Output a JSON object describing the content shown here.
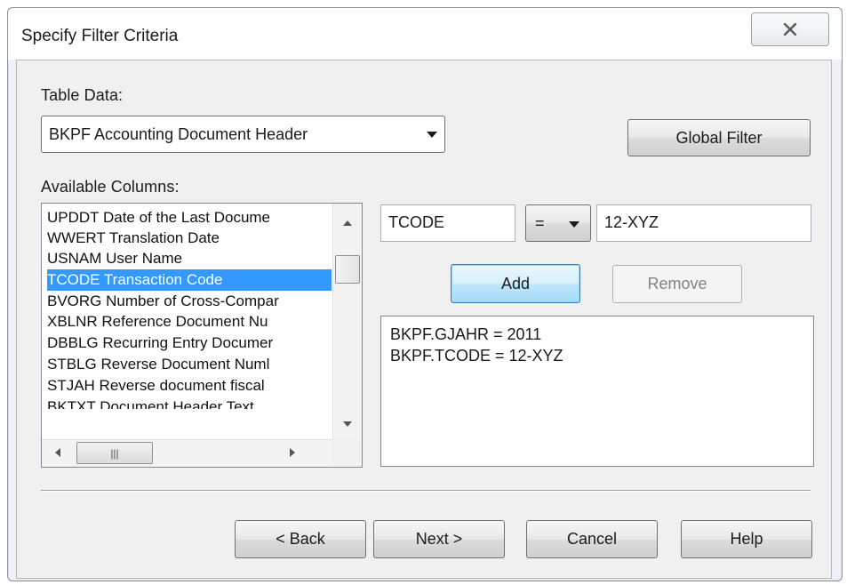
{
  "window": {
    "title": "Specify Filter Criteria"
  },
  "table_data": {
    "label": "Table Data:",
    "selected": "BKPF Accounting Document Header"
  },
  "buttons": {
    "global_filter": "Global Filter",
    "add": "Add",
    "remove": "Remove",
    "back": "< Back",
    "next": "Next >",
    "cancel": "Cancel",
    "help": "Help"
  },
  "available_columns": {
    "label": "Available Columns:",
    "items": [
      "UPDDT Date of the Last Docume",
      "WWERT Translation Date",
      "USNAM User Name",
      "TCODE Transaction Code",
      "BVORG Number of Cross-Compar",
      "XBLNR Reference Document Nu",
      "DBBLG Recurring Entry Documer",
      "STBLG Reverse Document Numl",
      "STJAH Reverse document fiscal",
      "BKTXT Document Header Text"
    ],
    "selected_index": 3
  },
  "filter": {
    "field": "TCODE",
    "operator": "=",
    "value": "12-XYZ"
  },
  "criteria": [
    "BKPF.GJAHR = 2011",
    "BKPF.TCODE = 12-XYZ"
  ],
  "icons": {
    "close": "close-icon",
    "dropdown": "chevron-down-icon",
    "scroll_up": "scroll-up-arrow-icon",
    "scroll_down": "scroll-down-arrow-icon",
    "scroll_left": "scroll-left-arrow-icon",
    "scroll_right": "scroll-right-arrow-icon",
    "grip": "scroll-grip-icon"
  },
  "colors": {
    "selection": "#3399ff",
    "default_button": "#bee6fd"
  }
}
